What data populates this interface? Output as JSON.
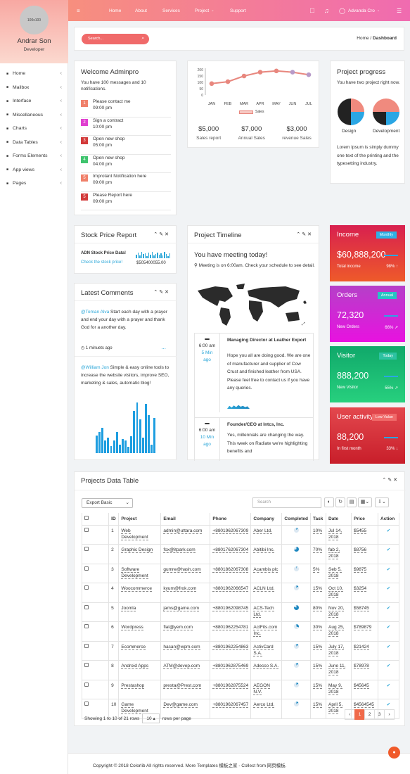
{
  "sidebar": {
    "avatar": "100x100",
    "name": "Andrar Son",
    "role": "Developer",
    "items": [
      {
        "icon": "home-icon",
        "label": "Home"
      },
      {
        "icon": "mailbox-icon",
        "label": "Mailbox"
      },
      {
        "icon": "interface-icon",
        "label": "Interface"
      },
      {
        "icon": "misc-icon",
        "label": "Miscellaneous"
      },
      {
        "icon": "charts-icon",
        "label": "Charts"
      },
      {
        "icon": "table-icon",
        "label": "Data Tables"
      },
      {
        "icon": "forms-icon",
        "label": "Forms Elements"
      },
      {
        "icon": "app-icon",
        "label": "App views"
      },
      {
        "icon": "pages-icon",
        "label": "Pages"
      }
    ]
  },
  "topbar": {
    "nav": [
      "Home",
      "About",
      "Services",
      "Project",
      "Support"
    ],
    "user": "Advanda Cro"
  },
  "header": {
    "search_placeholder": "Search...",
    "crumb_home": "Home",
    "crumb_sep": "/",
    "crumb_current": "Dashboard"
  },
  "welcome": {
    "title": "Welcome Adminpro",
    "subtitle": "You have 100 messages and 10 notifications.",
    "items": [
      {
        "n": "1",
        "color": "#f0806a",
        "text": "Please contact me",
        "time": "09:00 pm"
      },
      {
        "n": "2",
        "color": "#e040d0",
        "text": "Sign a contract",
        "time": "10:00 pm"
      },
      {
        "n": "3",
        "color": "#d23a3a",
        "text": "Open new shop",
        "time": "05:00 pm"
      },
      {
        "n": "4",
        "color": "#3fc46e",
        "text": "Open new shop",
        "time": "04:00 pm"
      },
      {
        "n": "5",
        "color": "#f0806a",
        "text": "Improtant Notification here",
        "time": "09:00 pm"
      },
      {
        "n": "5",
        "color": "#d23a3a",
        "text": "Please Report here",
        "time": "09:00 pm"
      }
    ]
  },
  "sales": {
    "report_value": "$5,000",
    "report_label": "Sales report",
    "annual_value": "$7,000",
    "annual_label": "Annual Sales",
    "revenue_value": "$3,000",
    "revenue_label": "revenue Sales"
  },
  "chart_data": {
    "type": "line",
    "categories": [
      "JAN",
      "FEB",
      "MAR",
      "APR",
      "MAY",
      "JUN",
      "JUL"
    ],
    "series": [
      {
        "name": "Sales",
        "values": [
          90,
          105,
          150,
          180,
          190,
          180,
          160
        ]
      }
    ],
    "ylim": [
      0,
      200
    ],
    "yticks": [
      "200",
      "150",
      "100",
      "50",
      "0"
    ],
    "legend": "bottom",
    "color": "#e8877e"
  },
  "progress": {
    "title": "Project progress",
    "subtitle": "You have two project right now.",
    "design_label": "Design",
    "development_label": "Development",
    "text": "Lorem Ipsum is simply dummy one text of the printing and the typesetting industry."
  },
  "stock": {
    "title": "Stock Price Report",
    "name": "ADN Stock Price Data!",
    "link": "Check the stock price!",
    "value": "$505400055.00"
  },
  "timeline": {
    "title": "Project Timeline",
    "heading": "You have meeting today!",
    "note": "Meeting is on 6:00am. Check your schedule to see detail.",
    "items": [
      {
        "time": "6:00 am",
        "ago": "5 Min ago",
        "title": "Managing Director at Leather Export",
        "text": "Hope you all are doing good. We are one of manufacturer and supplier of Cow Crust and finished leather from USA. Please feel free to contact us if you have any queries."
      },
      {
        "time": "6:00 am",
        "ago": "10 Min ago",
        "title": "Founder/CEO at Intcs, Inc.",
        "text": "Yes, millennials are changing the way. This week on Radiate we're highlighting benefits and"
      }
    ]
  },
  "comments": {
    "title": "Latest Comments",
    "c1_user": "@Toman Alva",
    "c1_text": "Start each day with a prayer and end your day with a prayer and thank God for a another day.",
    "c1_time": "1 minuets ago",
    "more": "...",
    "c2_user": "@William Jon",
    "c2_text": "Simple & easy online tools to increase the website visitors, improve SEO, marketing & sales, automatic blog!"
  },
  "stats": [
    {
      "title": "Income",
      "badge": "Monthly",
      "value": "$60,888,200",
      "label": "Total income",
      "pct": "98%",
      "bg": "linear-gradient(#d8204f,#ee5a2a)",
      "bbg": "#2eb0e4"
    },
    {
      "title": "Orders",
      "badge": "Annual",
      "value": "72,320",
      "label": "New Orders",
      "pct": "66%",
      "bg": "linear-gradient(#b540c8,#e812e0)",
      "bbg": "#27c4c4"
    },
    {
      "title": "Visitor",
      "badge": "Today",
      "value": "888,200",
      "label": "New Visitor",
      "pct": "55%",
      "bg": "linear-gradient(#10a86a,#27d07e)",
      "bbg": "#2dc2a2"
    },
    {
      "title": "User activity",
      "badge": "Low Value",
      "value": "88,200",
      "label": "In first month",
      "pct": "33%",
      "bg": "linear-gradient(#e3484e,#c81e2a)",
      "bbg": "#f06a6a"
    }
  ],
  "table": {
    "title": "Projects Data Table",
    "export": "Export Basic",
    "search_placeholder": "Search",
    "columns": [
      "ID",
      "Project",
      "Email",
      "Phone",
      "Company",
      "Completed",
      "Task",
      "Date",
      "Price",
      "Action"
    ],
    "rows": [
      {
        "id": "1",
        "project": "Web Development",
        "email": "admin@uttara.com",
        "phone": "+8801962067309",
        "company": "Aber Ltd.",
        "task": "10%",
        "date": "Jul 14, 2018",
        "price": "$5455",
        "pie": 10
      },
      {
        "id": "2",
        "project": "Graphic Design",
        "email": "fox@itpark.com",
        "phone": "+8801762067304",
        "company": "Abitibi Inc.",
        "task": "70%",
        "date": "fab 2, 2018",
        "price": "$8756",
        "pie": 70
      },
      {
        "id": "3",
        "project": "Software Development",
        "email": "gumre@hash.com",
        "phone": "+8801862067308",
        "company": "Acambis plc",
        "task": "5%",
        "date": "Seb 5, 2018",
        "price": "$9875",
        "pie": 5
      },
      {
        "id": "4",
        "project": "Woocommerce",
        "email": "kyum@frok.com",
        "phone": "+8801962066547",
        "company": "ACLN Ltd.",
        "task": "15%",
        "date": "Oct 10, 2018",
        "price": "$3254",
        "pie": 15
      },
      {
        "id": "5",
        "project": "Joomla",
        "email": "jams@game.com",
        "phone": "+8801962098745",
        "company": "ACS-Tech Ltd.",
        "task": "80%",
        "date": "Nov 20, 2018",
        "price": "$58745",
        "pie": 80
      },
      {
        "id": "6",
        "project": "Wordpress",
        "email": "flat@yem.com",
        "phone": "+8801962254781",
        "company": "ActFits.com Inc.",
        "task": "30%",
        "date": "Aug 25, 2018",
        "price": "$789879",
        "pie": 30
      },
      {
        "id": "7",
        "project": "Ecommerce",
        "email": "hasan@wpm.com",
        "phone": "+8801962254863",
        "company": "ActivCard S.A.",
        "task": "15%",
        "date": "July 17, 2018",
        "price": "$21424",
        "pie": 15
      },
      {
        "id": "8",
        "project": "Android Apps",
        "email": "ATM@devep.com",
        "phone": "+8801962875469",
        "company": "Adecco S.A.",
        "task": "15%",
        "date": "June 11, 2018",
        "price": "$78978",
        "pie": 15
      },
      {
        "id": "9",
        "project": "Prestashop",
        "email": "presta@Prest.com",
        "phone": "+8801962875524",
        "company": "AEGON N.V.",
        "task": "15%",
        "date": "May 9, 2018",
        "price": "$45645",
        "pie": 15
      },
      {
        "id": "10",
        "project": "Game Development",
        "email": "Dev@game.com",
        "phone": "+8801962067457",
        "company": "Aerco Ltd.",
        "task": "15%",
        "date": "April 5, 2018",
        "price": "$4564545",
        "pie": 15
      }
    ],
    "footer_text": "Showing 1 to 10 of 21 rows",
    "per_page": "10",
    "per_page_label": "rows per page",
    "pages": [
      "‹",
      "1",
      "2",
      "3",
      "›"
    ]
  },
  "footer": {
    "text": "Copyright © 2018 Colorlib All rights reserved. More Templates 模板之家 - Collect from 网页模板."
  }
}
